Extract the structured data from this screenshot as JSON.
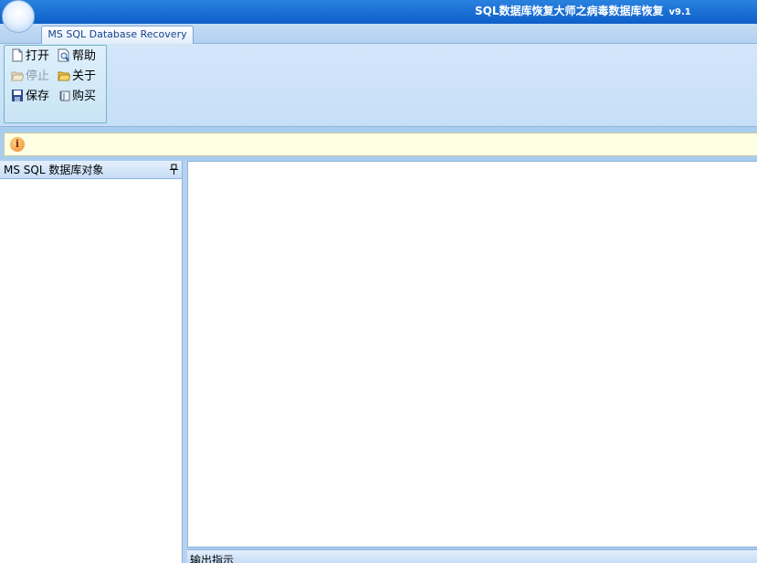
{
  "window": {
    "title": "SQL数据库恢复大师之病毒数据库恢复",
    "version": "v9.1"
  },
  "ribbon": {
    "tab": "MS SQL Database Recovery",
    "buttons": {
      "open": "打开",
      "help": "帮助",
      "stop": "停止",
      "about": "关于",
      "save": "保存",
      "buy": "购买"
    }
  },
  "infobar": {
    "icon": "info-icon",
    "text": ""
  },
  "left_panel": {
    "title": "MS SQL 数据库对象",
    "pin_icon": "pin-icon"
  },
  "output_panel": {
    "title": "输出指示"
  },
  "colors": {
    "titlebar": "#0d5fc9",
    "ribbon": "#c6def7",
    "infobar": "#ffffe3"
  }
}
